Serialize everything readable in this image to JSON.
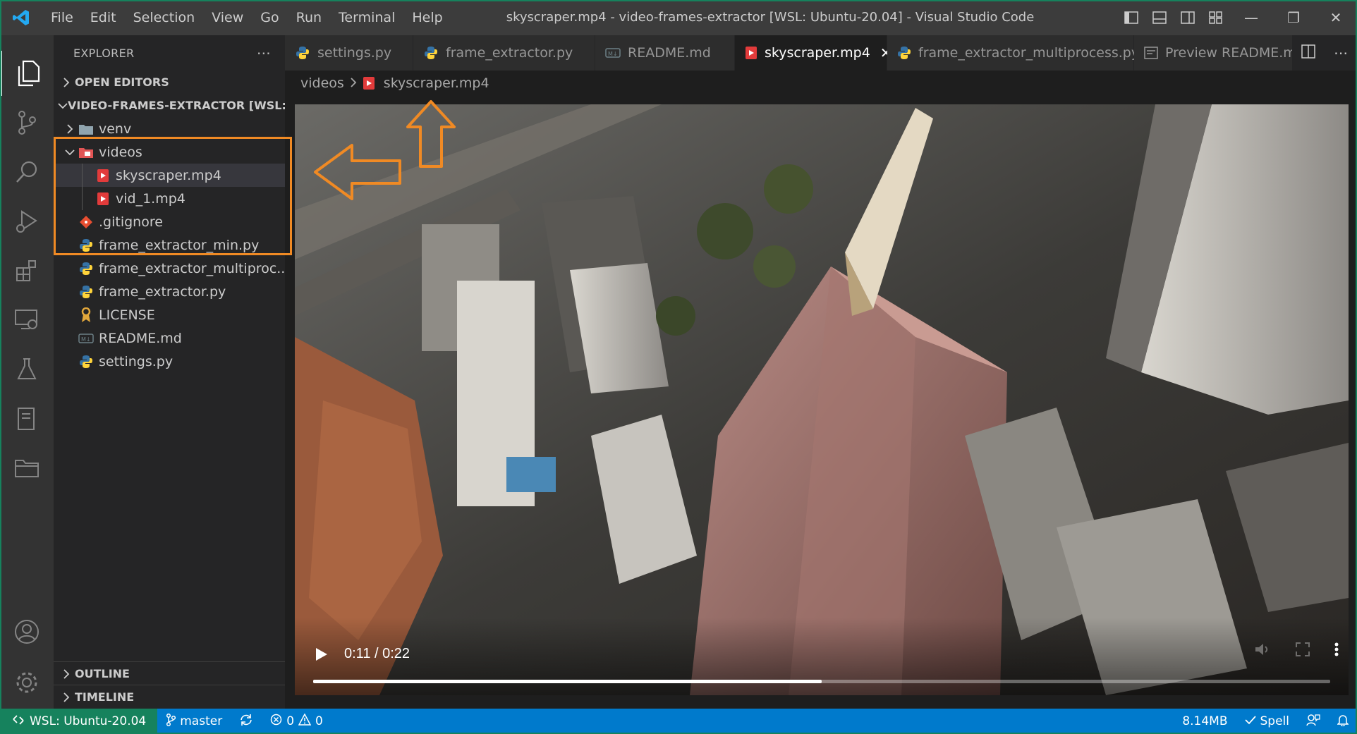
{
  "window": {
    "title": "skyscraper.mp4 - video-frames-extractor [WSL: Ubuntu-20.04] - Visual Studio Code",
    "menu": [
      "File",
      "Edit",
      "Selection",
      "View",
      "Go",
      "Run",
      "Terminal",
      "Help"
    ]
  },
  "sidebar": {
    "header": "EXPLORER",
    "open_editors": "OPEN EDITORS",
    "project": "VIDEO-FRAMES-EXTRACTOR [WSL: ...",
    "tree": [
      {
        "label": "venv",
        "kind": "folder"
      },
      {
        "label": "videos",
        "kind": "folder-open"
      },
      {
        "label": "skyscraper.mp4",
        "kind": "video",
        "selected": true
      },
      {
        "label": "vid_1.mp4",
        "kind": "video"
      },
      {
        "label": ".gitignore",
        "kind": "git"
      },
      {
        "label": "frame_extractor_min.py",
        "kind": "python"
      },
      {
        "label": "frame_extractor_multiproc...",
        "kind": "python"
      },
      {
        "label": "frame_extractor.py",
        "kind": "python"
      },
      {
        "label": "LICENSE",
        "kind": "license"
      },
      {
        "label": "README.md",
        "kind": "markdown"
      },
      {
        "label": "settings.py",
        "kind": "python"
      }
    ],
    "outline": "OUTLINE",
    "timeline": "TIMELINE"
  },
  "tabs": [
    {
      "label": "settings.py",
      "kind": "python"
    },
    {
      "label": "frame_extractor.py",
      "kind": "python"
    },
    {
      "label": "README.md",
      "kind": "markdown"
    },
    {
      "label": "skyscraper.mp4",
      "kind": "video",
      "active": true
    },
    {
      "label": "frame_extractor_multiprocess.py",
      "kind": "python"
    },
    {
      "label": "Preview README.md",
      "kind": "preview"
    }
  ],
  "breadcrumb": {
    "folder": "videos",
    "file": "skyscraper.mp4"
  },
  "video": {
    "time": "0:11 / 0:22",
    "progress": 0.5
  },
  "statusbar": {
    "remote": "WSL: Ubuntu-20.04",
    "branch": "master",
    "errors": "0",
    "warnings": "0",
    "size": "8.14MB",
    "spell": "Spell"
  },
  "colors": {
    "accent": "#007acc",
    "remote": "#16825d",
    "annotation": "#f08a24",
    "video_icon": "#e23b3b",
    "python_blue": "#3572a5",
    "python_yellow": "#ffd43b"
  }
}
